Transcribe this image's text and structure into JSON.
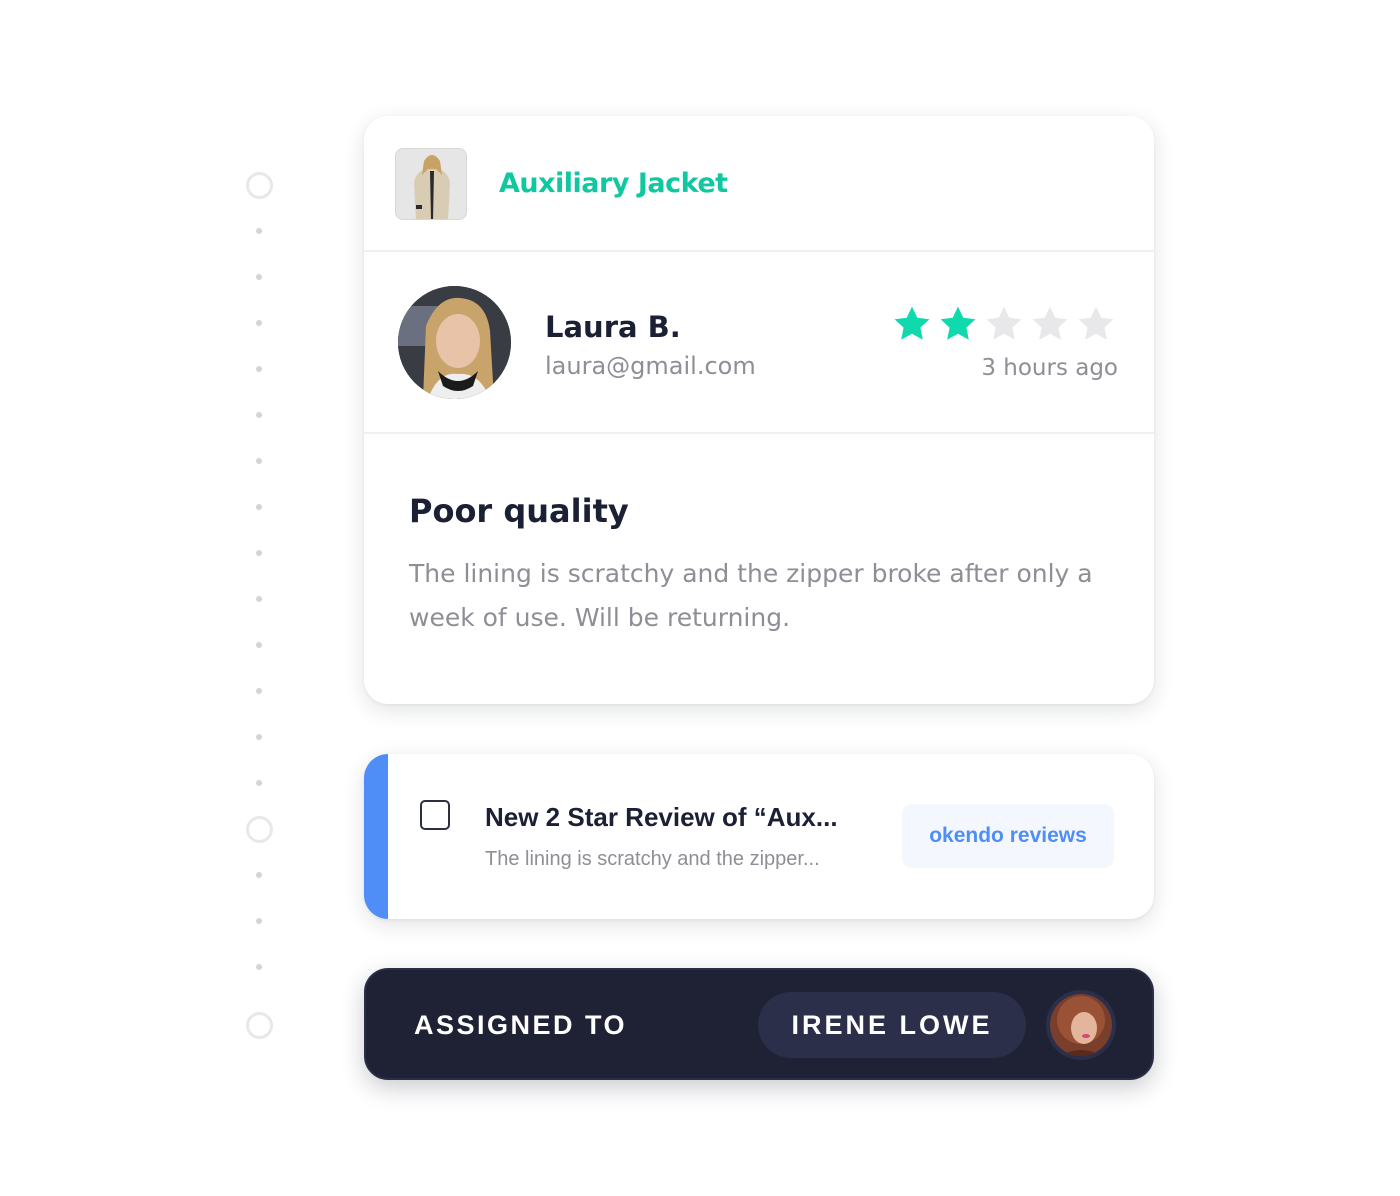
{
  "review_card": {
    "product": {
      "name": "Auxiliary Jacket",
      "thumbnail_icon": "product-photo-jacket"
    },
    "reviewer": {
      "name": "Laura B.",
      "email": "laura@gmail.com",
      "avatar_icon": "reviewer-photo"
    },
    "rating": {
      "value": 2,
      "max": 5,
      "filled_color": "#10d9ad",
      "empty_color": "#e8e8ea"
    },
    "time_ago": "3 hours ago",
    "title": "Poor quality",
    "body": "The lining is scratchy and the zipper broke after only a week of use. Will be returning."
  },
  "notification": {
    "title": "New 2 Star Review of “Aux...",
    "snippet": "The lining is scratchy and the zipper...",
    "source": "okendo reviews",
    "accent_color": "#4f8ef7",
    "checked": false
  },
  "assignment": {
    "label": "ASSIGNED TO",
    "assignee": "IRENE LOWE",
    "avatar_icon": "assignee-photo"
  },
  "colors": {
    "brand_green": "#10c8a0",
    "dark_navy": "#1f2235",
    "text_dark": "#1c2035",
    "text_muted": "#8e8e96"
  }
}
